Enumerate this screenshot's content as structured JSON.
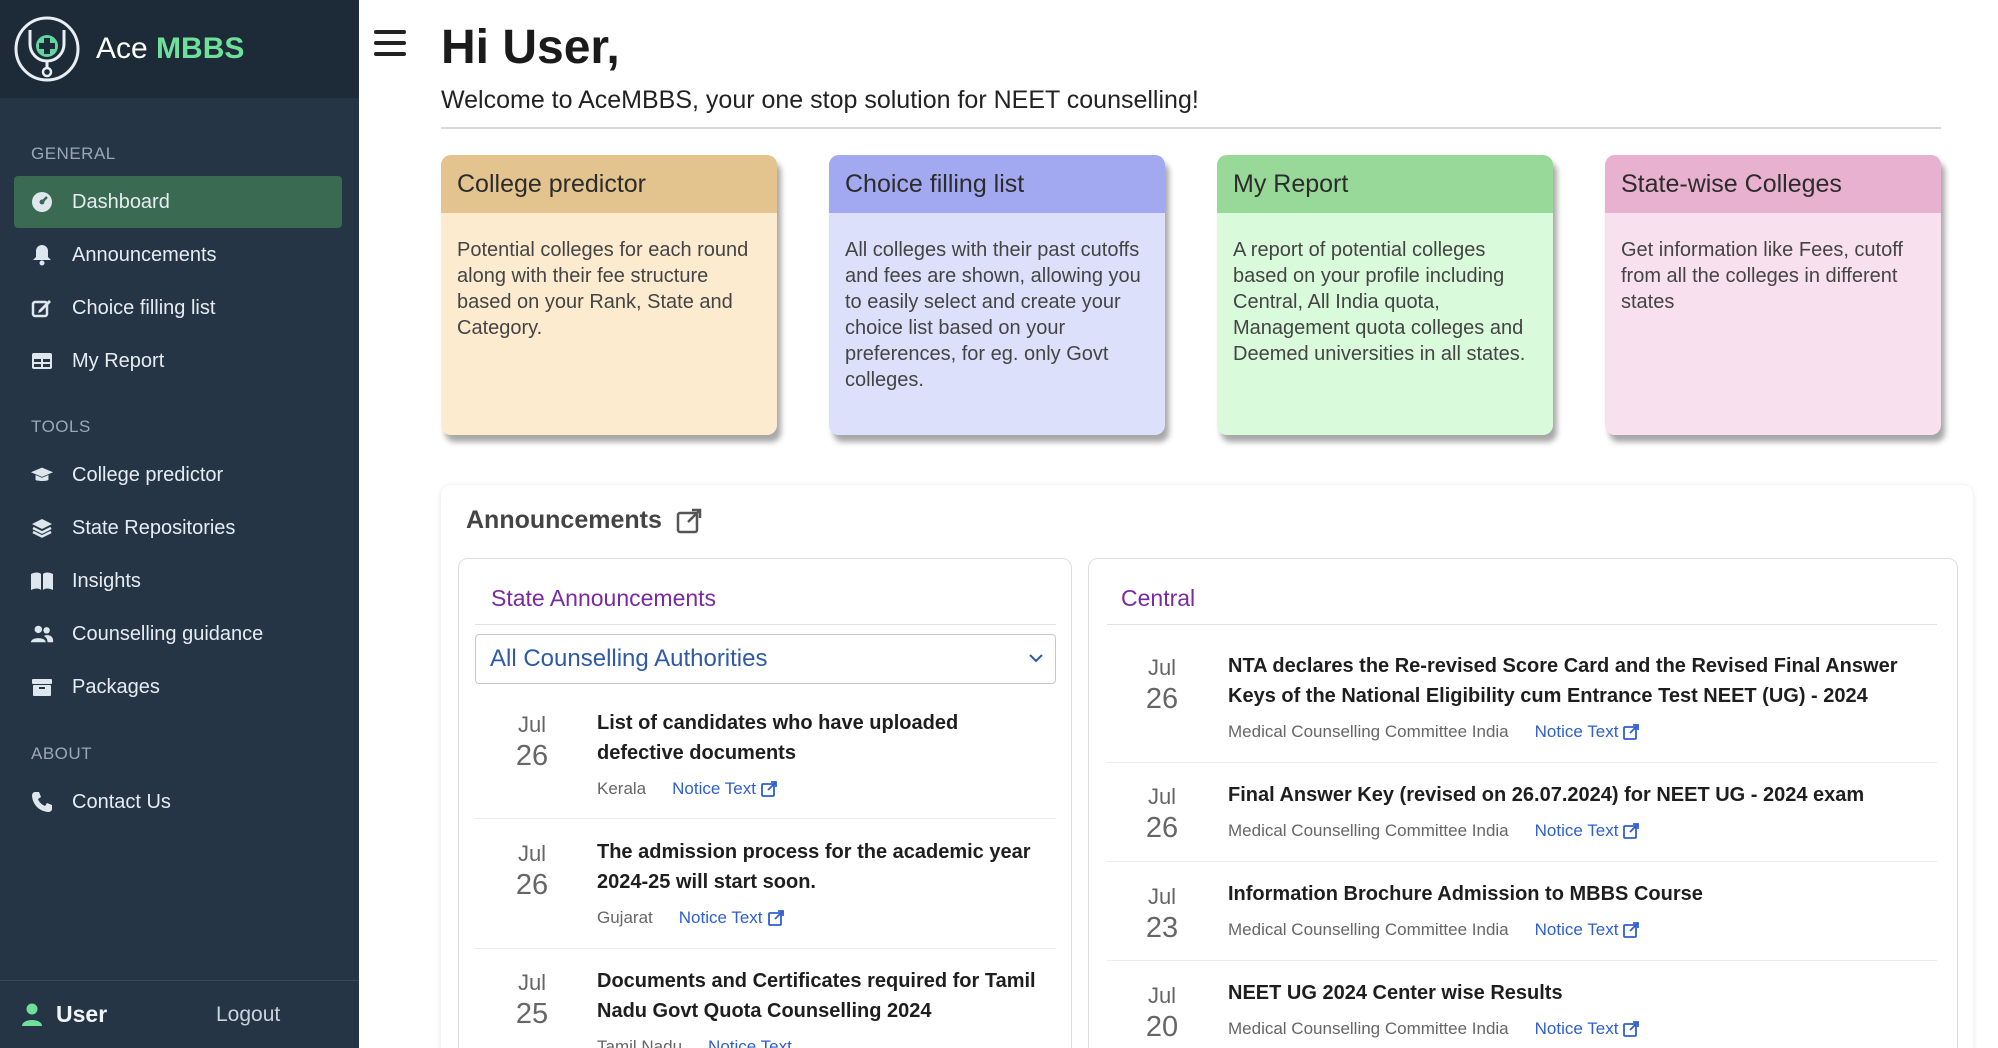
{
  "brand": {
    "name_prefix": "Ace",
    "name_accent": "MBBS"
  },
  "sidebar": {
    "general_label": "GENERAL",
    "tools_label": "TOOLS",
    "about_label": "ABOUT",
    "general_items": [
      {
        "label": "Dashboard",
        "icon": "dashboard-icon",
        "active": true
      },
      {
        "label": "Announcements",
        "icon": "bell-icon"
      },
      {
        "label": "Choice filling list",
        "icon": "edit-icon"
      },
      {
        "label": "My Report",
        "icon": "table-icon"
      }
    ],
    "tools_items": [
      {
        "label": "College predictor",
        "icon": "graduation-cap-icon"
      },
      {
        "label": "State Repositories",
        "icon": "layers-icon"
      },
      {
        "label": "Insights",
        "icon": "book-icon"
      },
      {
        "label": "Counselling guidance",
        "icon": "users-icon"
      },
      {
        "label": "Packages",
        "icon": "archive-icon"
      }
    ],
    "about_items": [
      {
        "label": "Contact Us",
        "icon": "phone-icon"
      }
    ],
    "footer": {
      "user": "User",
      "logout": "Logout"
    }
  },
  "header": {
    "greeting": "Hi User,",
    "welcome": "Welcome to AceMBBS, your one stop solution for NEET counselling!"
  },
  "cards": [
    {
      "title": "College predictor",
      "body": "Potential colleges for each round along with their fee structure based on your Rank, State and Category.",
      "head_color": "#e3c48f",
      "body_color": "#fdebd0"
    },
    {
      "title": "Choice filling list",
      "body": "All colleges with their past cutoffs and fees are shown, allowing you to easily select and create your choice list based on your preferences, for eg. only Govt colleges.",
      "head_color": "#a2a9f0",
      "body_color": "#dde0fb"
    },
    {
      "title": "My Report",
      "body": "A report of potential colleges based on your profile including Central, All India quota, Management quota colleges and Deemed universities in all states.",
      "head_color": "#98d99a",
      "body_color": "#d9fbdc"
    },
    {
      "title": "State-wise Colleges",
      "body": "Get information like Fees, cutoff from all the colleges in different states",
      "head_color": "#e8b1cf",
      "body_color": "#f8e0ee"
    }
  ],
  "announcements": {
    "title": "Announcements",
    "state": {
      "title": "State Announcements",
      "filter_selected": "All Counselling Authorities",
      "items": [
        {
          "month": "Jul",
          "day": "26",
          "title": "List of candidates who have uploaded defective documents",
          "source": "Kerala",
          "link": "Notice Text"
        },
        {
          "month": "Jul",
          "day": "26",
          "title": "The admission process for the academic year 2024-25 will start soon.",
          "source": "Gujarat",
          "link": "Notice Text"
        },
        {
          "month": "Jul",
          "day": "25",
          "title": "Documents and Certificates required for Tamil Nadu Govt Quota Counselling 2024",
          "source": "Tamil Nadu",
          "link": "Notice Text"
        }
      ]
    },
    "central": {
      "title": "Central",
      "items": [
        {
          "month": "Jul",
          "day": "26",
          "title": "NTA declares the Re-revised Score Card and the Revised Final Answer Keys of the National Eligibility cum Entrance Test NEET (UG) - 2024",
          "source": "Medical Counselling Committee India",
          "link": "Notice Text"
        },
        {
          "month": "Jul",
          "day": "26",
          "title": "Final Answer Key (revised on 26.07.2024) for NEET UG - 2024 exam",
          "source": "Medical Counselling Committee India",
          "link": "Notice Text"
        },
        {
          "month": "Jul",
          "day": "23",
          "title": "Information Brochure Admission to MBBS Course",
          "source": "Medical Counselling Committee India",
          "link": "Notice Text"
        },
        {
          "month": "Jul",
          "day": "20",
          "title": "NEET UG 2024 Center wise Results",
          "source": "Medical Counselling Committee India",
          "link": "Notice Text"
        }
      ]
    }
  }
}
